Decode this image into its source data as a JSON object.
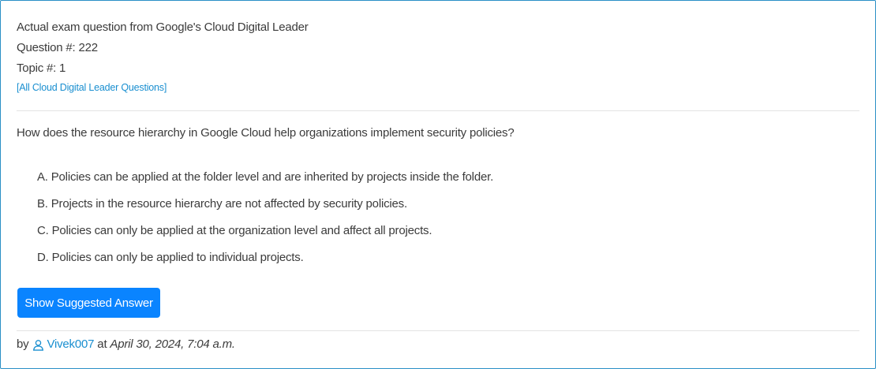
{
  "header": {
    "exam_line": "Actual exam question from Google's Cloud Digital Leader",
    "question_number": "Question #: 222",
    "topic_number": "Topic #: 1",
    "all_questions_link": "[All Cloud Digital Leader Questions]"
  },
  "question": {
    "text": "How does the resource hierarchy in Google Cloud help organizations implement security policies?",
    "choices": [
      "A. Policies can be applied at the folder level and are inherited by projects inside the folder.",
      "B. Projects in the resource hierarchy are not affected by security policies.",
      "C. Policies can only be applied at the organization level and affect all projects.",
      "D. Policies can only be applied to individual projects."
    ]
  },
  "actions": {
    "show_answer_label": "Show Suggested Answer"
  },
  "footer": {
    "by_label": "by",
    "username": "Vivek007",
    "at_label": "at",
    "date": "April 30, 2024, 7:04 a.m."
  },
  "colors": {
    "accent": "#0a84ff",
    "link": "#1a8fd0",
    "border": "#2a8fc6",
    "text": "#3b3b3b"
  },
  "icons": {
    "user": "user-icon"
  }
}
